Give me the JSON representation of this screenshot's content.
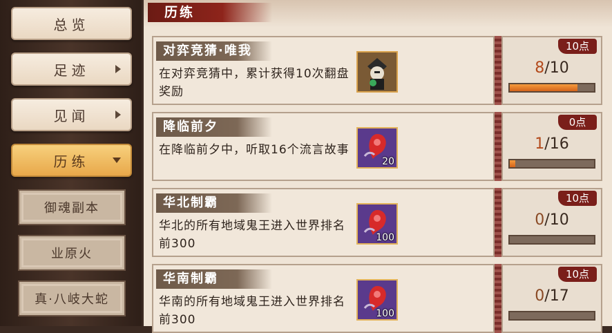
{
  "sidebar": {
    "items": [
      {
        "label": "总览",
        "arrow": "none"
      },
      {
        "label": "足迹",
        "arrow": "right"
      },
      {
        "label": "见闻",
        "arrow": "right"
      },
      {
        "label": "历练",
        "arrow": "down",
        "active": true
      }
    ],
    "sub_items": [
      {
        "label": "御魂副本"
      },
      {
        "label": "业原火"
      },
      {
        "label": "真·八岐大蛇"
      }
    ]
  },
  "header": {
    "title": "历练"
  },
  "tasks": [
    {
      "title": "对弈竞猜·唯我",
      "desc": "在对弈竞猜中，累计获得10次翻盘奖励",
      "reward_icon": "shikigami-portrait-icon",
      "reward_count": "",
      "points": "10点",
      "current": "8",
      "total": "/10",
      "progress": 0.8
    },
    {
      "title": "降临前夕",
      "desc": "在降临前夕中，听取16个流言故事",
      "reward_icon": "red-magatama-icon",
      "reward_count": "20",
      "points": "0点",
      "current": "1",
      "total": "/16",
      "progress": 0.0625
    },
    {
      "title": "华北制霸",
      "desc": "华北的所有地域鬼王进入世界排名前300",
      "reward_icon": "red-magatama-icon",
      "reward_count": "100",
      "points": "10点",
      "current": "0",
      "total": "/10",
      "progress": 0
    },
    {
      "title": "华南制霸",
      "desc": "华南的所有地域鬼王进入世界排名前300",
      "reward_icon": "red-magatama-icon",
      "reward_count": "100",
      "points": "10点",
      "current": "0",
      "total": "/17",
      "progress": 0
    }
  ],
  "colors": {
    "accent": "#7a1f1a",
    "progress": "#e07a28",
    "active_nav": "#f2bf68"
  }
}
